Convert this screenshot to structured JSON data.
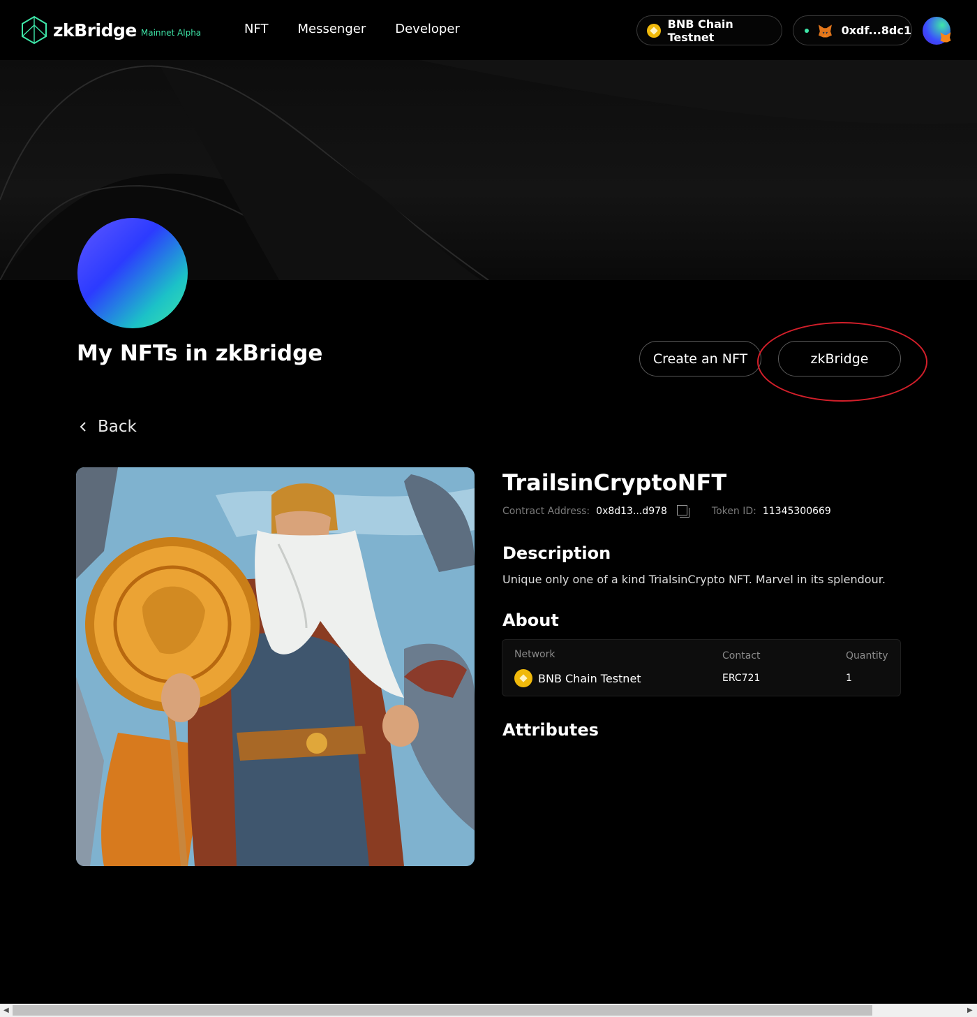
{
  "header": {
    "logo_text": "zkBridge",
    "logo_tag": "Mainnet Alpha",
    "nav": [
      "NFT",
      "Messenger",
      "Developer"
    ],
    "network_label": "BNB Chain Testnet",
    "wallet_address": "0xdf...8dc1"
  },
  "page": {
    "title": "My NFTs in zkBridge",
    "create_button": "Create an NFT",
    "zkbridge_button": "zkBridge",
    "back_label": "Back"
  },
  "nft": {
    "name": "TrailsinCryptoNFT",
    "contract_label": "Contract Address:",
    "contract_value": "0x8d13...d978",
    "token_label": "Token ID:",
    "token_value": "11345300669",
    "description_title": "Description",
    "description": "Unique only one of a kind TrialsinCrypto NFT. Marvel in its splendour.",
    "about_title": "About",
    "about": {
      "network_header": "Network",
      "network_value": "BNB Chain Testnet",
      "contact_header": "Contact",
      "contact_value": "ERC721",
      "quantity_header": "Quantity",
      "quantity_value": "1"
    },
    "attributes_title": "Attributes"
  },
  "colors": {
    "accent_green": "#3ee6a8",
    "bnb_yellow": "#f0b90b",
    "annotation_red": "#d21f2a"
  }
}
